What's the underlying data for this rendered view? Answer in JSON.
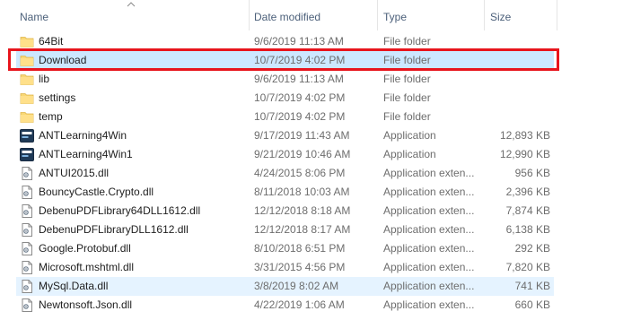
{
  "columns": {
    "name": "Name",
    "date_modified": "Date modified",
    "type": "Type",
    "size": "Size"
  },
  "files": [
    {
      "name": "64Bit",
      "date": "9/6/2019 11:13 AM",
      "type": "File folder",
      "size": "",
      "icon": "folder-icon"
    },
    {
      "name": "Download",
      "date": "10/7/2019 4:02 PM",
      "type": "File folder",
      "size": "",
      "icon": "folder-icon",
      "state": "selected"
    },
    {
      "name": "lib",
      "date": "9/6/2019 11:13 AM",
      "type": "File folder",
      "size": "",
      "icon": "folder-icon"
    },
    {
      "name": "settings",
      "date": "10/7/2019 4:02 PM",
      "type": "File folder",
      "size": "",
      "icon": "folder-icon"
    },
    {
      "name": "temp",
      "date": "10/7/2019 4:02 PM",
      "type": "File folder",
      "size": "",
      "icon": "folder-icon"
    },
    {
      "name": "ANTLearning4Win",
      "date": "9/17/2019 11:43 AM",
      "type": "Application",
      "size": "12,893 KB",
      "icon": "application-icon"
    },
    {
      "name": "ANTLearning4Win1",
      "date": "9/21/2019 10:46 AM",
      "type": "Application",
      "size": "12,990 KB",
      "icon": "application-icon"
    },
    {
      "name": "ANTUI2015.dll",
      "date": "4/24/2015 8:06 PM",
      "type": "Application exten...",
      "size": "956 KB",
      "icon": "dll-file-icon"
    },
    {
      "name": "BouncyCastle.Crypto.dll",
      "date": "8/11/2018 10:03 AM",
      "type": "Application exten...",
      "size": "2,396 KB",
      "icon": "dll-file-icon"
    },
    {
      "name": "DebenuPDFLibrary64DLL1612.dll",
      "date": "12/12/2018 8:18 AM",
      "type": "Application exten...",
      "size": "7,874 KB",
      "icon": "dll-file-icon"
    },
    {
      "name": "DebenuPDFLibraryDLL1612.dll",
      "date": "12/12/2018 8:17 AM",
      "type": "Application exten...",
      "size": "6,138 KB",
      "icon": "dll-file-icon"
    },
    {
      "name": "Google.Protobuf.dll",
      "date": "8/10/2018 6:51 PM",
      "type": "Application exten...",
      "size": "292 KB",
      "icon": "dll-file-icon"
    },
    {
      "name": "Microsoft.mshtml.dll",
      "date": "3/31/2015 4:56 PM",
      "type": "Application exten...",
      "size": "7,820 KB",
      "icon": "dll-file-icon"
    },
    {
      "name": "MySql.Data.dll",
      "date": "3/8/2019 8:02 AM",
      "type": "Application exten...",
      "size": "741 KB",
      "icon": "dll-file-icon",
      "state": "hover"
    },
    {
      "name": "Newtonsoft.Json.dll",
      "date": "4/22/2019 1:06 AM",
      "type": "Application exten...",
      "size": "660 KB",
      "icon": "dll-file-icon"
    }
  ],
  "colors": {
    "selected_row": "#cce8ff",
    "hover_row": "#e5f3ff",
    "highlight_border": "#e8141c",
    "folder": "#f8d775",
    "header_text": "#4c607a"
  }
}
